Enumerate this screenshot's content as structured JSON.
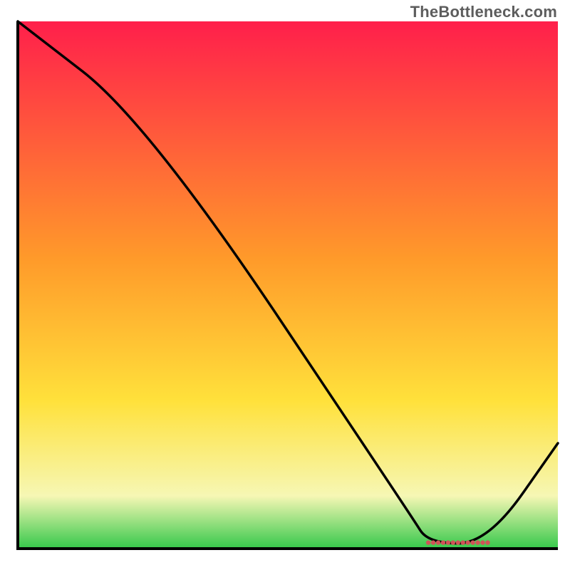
{
  "attribution": "TheBottleneck.com",
  "colors": {
    "curve": "#000000",
    "marker": "#d05458",
    "axis": "#000000",
    "grad_top": "#ff1f4b",
    "grad_mid1": "#ff7f2a",
    "grad_mid2": "#ffe13b",
    "grad_mid3": "#f6f7b4",
    "grad_bottom": "#35c84b"
  },
  "chart_data": {
    "type": "line",
    "title": "",
    "xlabel": "",
    "ylabel": "",
    "xlim": [
      0,
      100
    ],
    "ylim": [
      0,
      100
    ],
    "grid": false,
    "legend": false,
    "x": [
      0,
      24,
      73,
      76,
      87,
      100
    ],
    "values": [
      100,
      81,
      6,
      1,
      1,
      20
    ],
    "marker_segment": {
      "x_start": 76,
      "x_end": 87,
      "y": 1
    },
    "notes": "y is relative height 0–100 (no axis ticks in image); curve descends from top-left, shallow kink near x≈24, steep diagonal to a flat minimum around x≈76–87, then rises toward bottom-right corner."
  }
}
